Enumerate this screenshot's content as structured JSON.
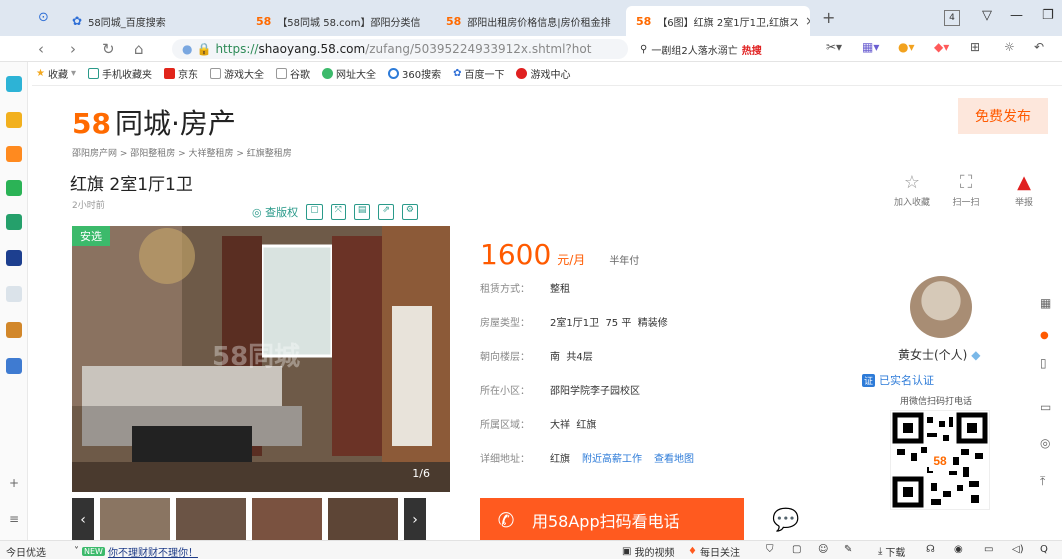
{
  "browser": {
    "tabs": [
      {
        "label": "58同城_百度搜索",
        "icon": "baidu-paw-icon"
      },
      {
        "label": "【58同城 58.com】邵阳分类信",
        "icon": "58-logo-icon"
      },
      {
        "label": "邵阳出租房价格信息|房价租金排",
        "icon": "58-logo-icon"
      },
      {
        "label": "【6图】红旗 2室1厅1卫,红旗ス",
        "icon": "58-logo-icon"
      }
    ],
    "new_tab": "+",
    "tab_count": "4",
    "url": {
      "https": "https://",
      "domain": "shaoyang.58.com",
      "path": "/zufang/50395224933912x.shtml?hot"
    },
    "search": {
      "query": "一剧组2人落水溺亡",
      "hot": "热搜"
    },
    "bookmarks": [
      "收藏",
      "手机收藏夹",
      "京东",
      "游戏大全",
      "谷歌",
      "网址大全",
      "360搜索",
      "百度一下",
      "游戏中心"
    ]
  },
  "page": {
    "logo": {
      "five": "5",
      "eight": "8",
      "text": "同城·房产"
    },
    "publish": "免费发布",
    "breadcrumb": "邵阳房产网 > 邵阳整租房 > 大祥整租房 > 红旗整租房",
    "title": "红旗 2室1厅1卫",
    "posted": "2小时前",
    "actions": [
      {
        "label": "加入收藏",
        "icon": "star-icon"
      },
      {
        "label": "扫一扫",
        "icon": "scan-icon"
      },
      {
        "label": "举报",
        "icon": "alarm-icon"
      }
    ],
    "mini_toolbar": {
      "copyright": "查版权"
    },
    "photo": {
      "badge": "安选",
      "counter": "1/6",
      "watermark": "58同城"
    },
    "price": {
      "value": "1600",
      "unit": "元/月",
      "pay": "半年付"
    },
    "details": [
      {
        "k": "租赁方式：",
        "v": "整租"
      },
      {
        "k": "房屋类型：",
        "v": "2室1厅1卫  75 平  精装修"
      },
      {
        "k": "朝向楼层：",
        "v": "南  共4层"
      },
      {
        "k": "所在小区：",
        "v": "邵阳学院李子园校区"
      },
      {
        "k": "所属区域：",
        "v": "大祥  红旗"
      },
      {
        "k": "详细地址：",
        "v": "红旗",
        "link1": "附近高薪工作",
        "link2": "查看地图"
      }
    ],
    "call": "用58App扫码看电话",
    "owner": {
      "name": "黄女士(个人)",
      "verified": "已实名认证",
      "id_badge": "证",
      "wx_note": "用微信扫码打电话"
    }
  },
  "status": {
    "daily": "今日优选",
    "new": "NEW",
    "headline": "你不理财财不理你！",
    "video": "我的视频",
    "focus": "每日关注",
    "download": "下载"
  }
}
